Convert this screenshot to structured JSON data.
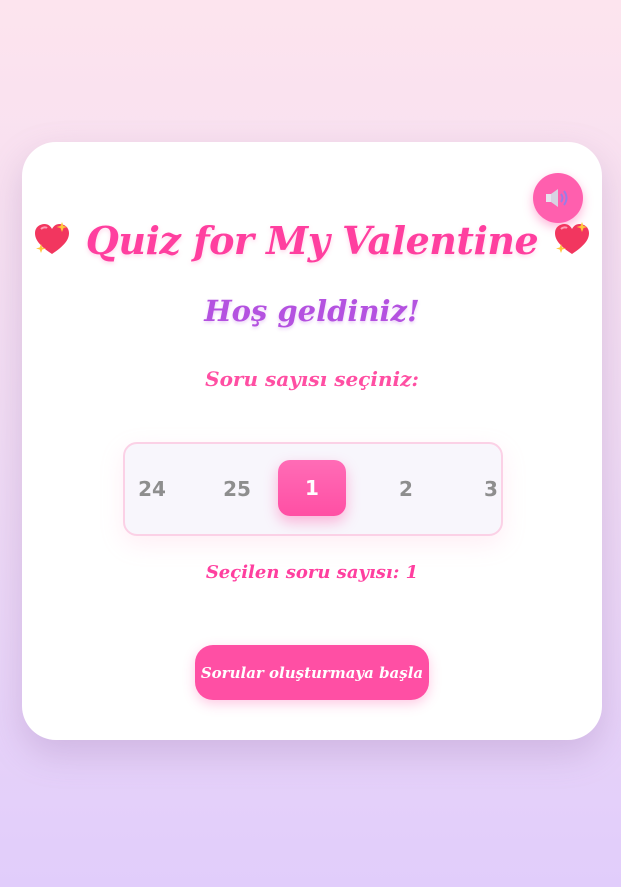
{
  "header": {
    "title": "Quiz for My Valentine",
    "left_icon": "sparkling-heart-icon",
    "right_icon": "sparkling-heart-icon"
  },
  "sound_toggle": {
    "icon": "speaker-icon"
  },
  "welcome": "Hoş geldiniz!",
  "question_count": {
    "label": "Soru sayısı seçiniz:",
    "options": [
      "24",
      "25",
      "1",
      "2",
      "3"
    ],
    "selected": "1",
    "selected_prefix": "Seçilen soru sayısı:",
    "selected_text": "Seçilen soru sayısı: 1"
  },
  "start_button": {
    "label": "Sorular oluşturmaya başla"
  },
  "colors": {
    "accent": "#ff4fa4",
    "title": "#ff3f9f",
    "welcome": "#b452e0",
    "card": "#ffffff"
  }
}
